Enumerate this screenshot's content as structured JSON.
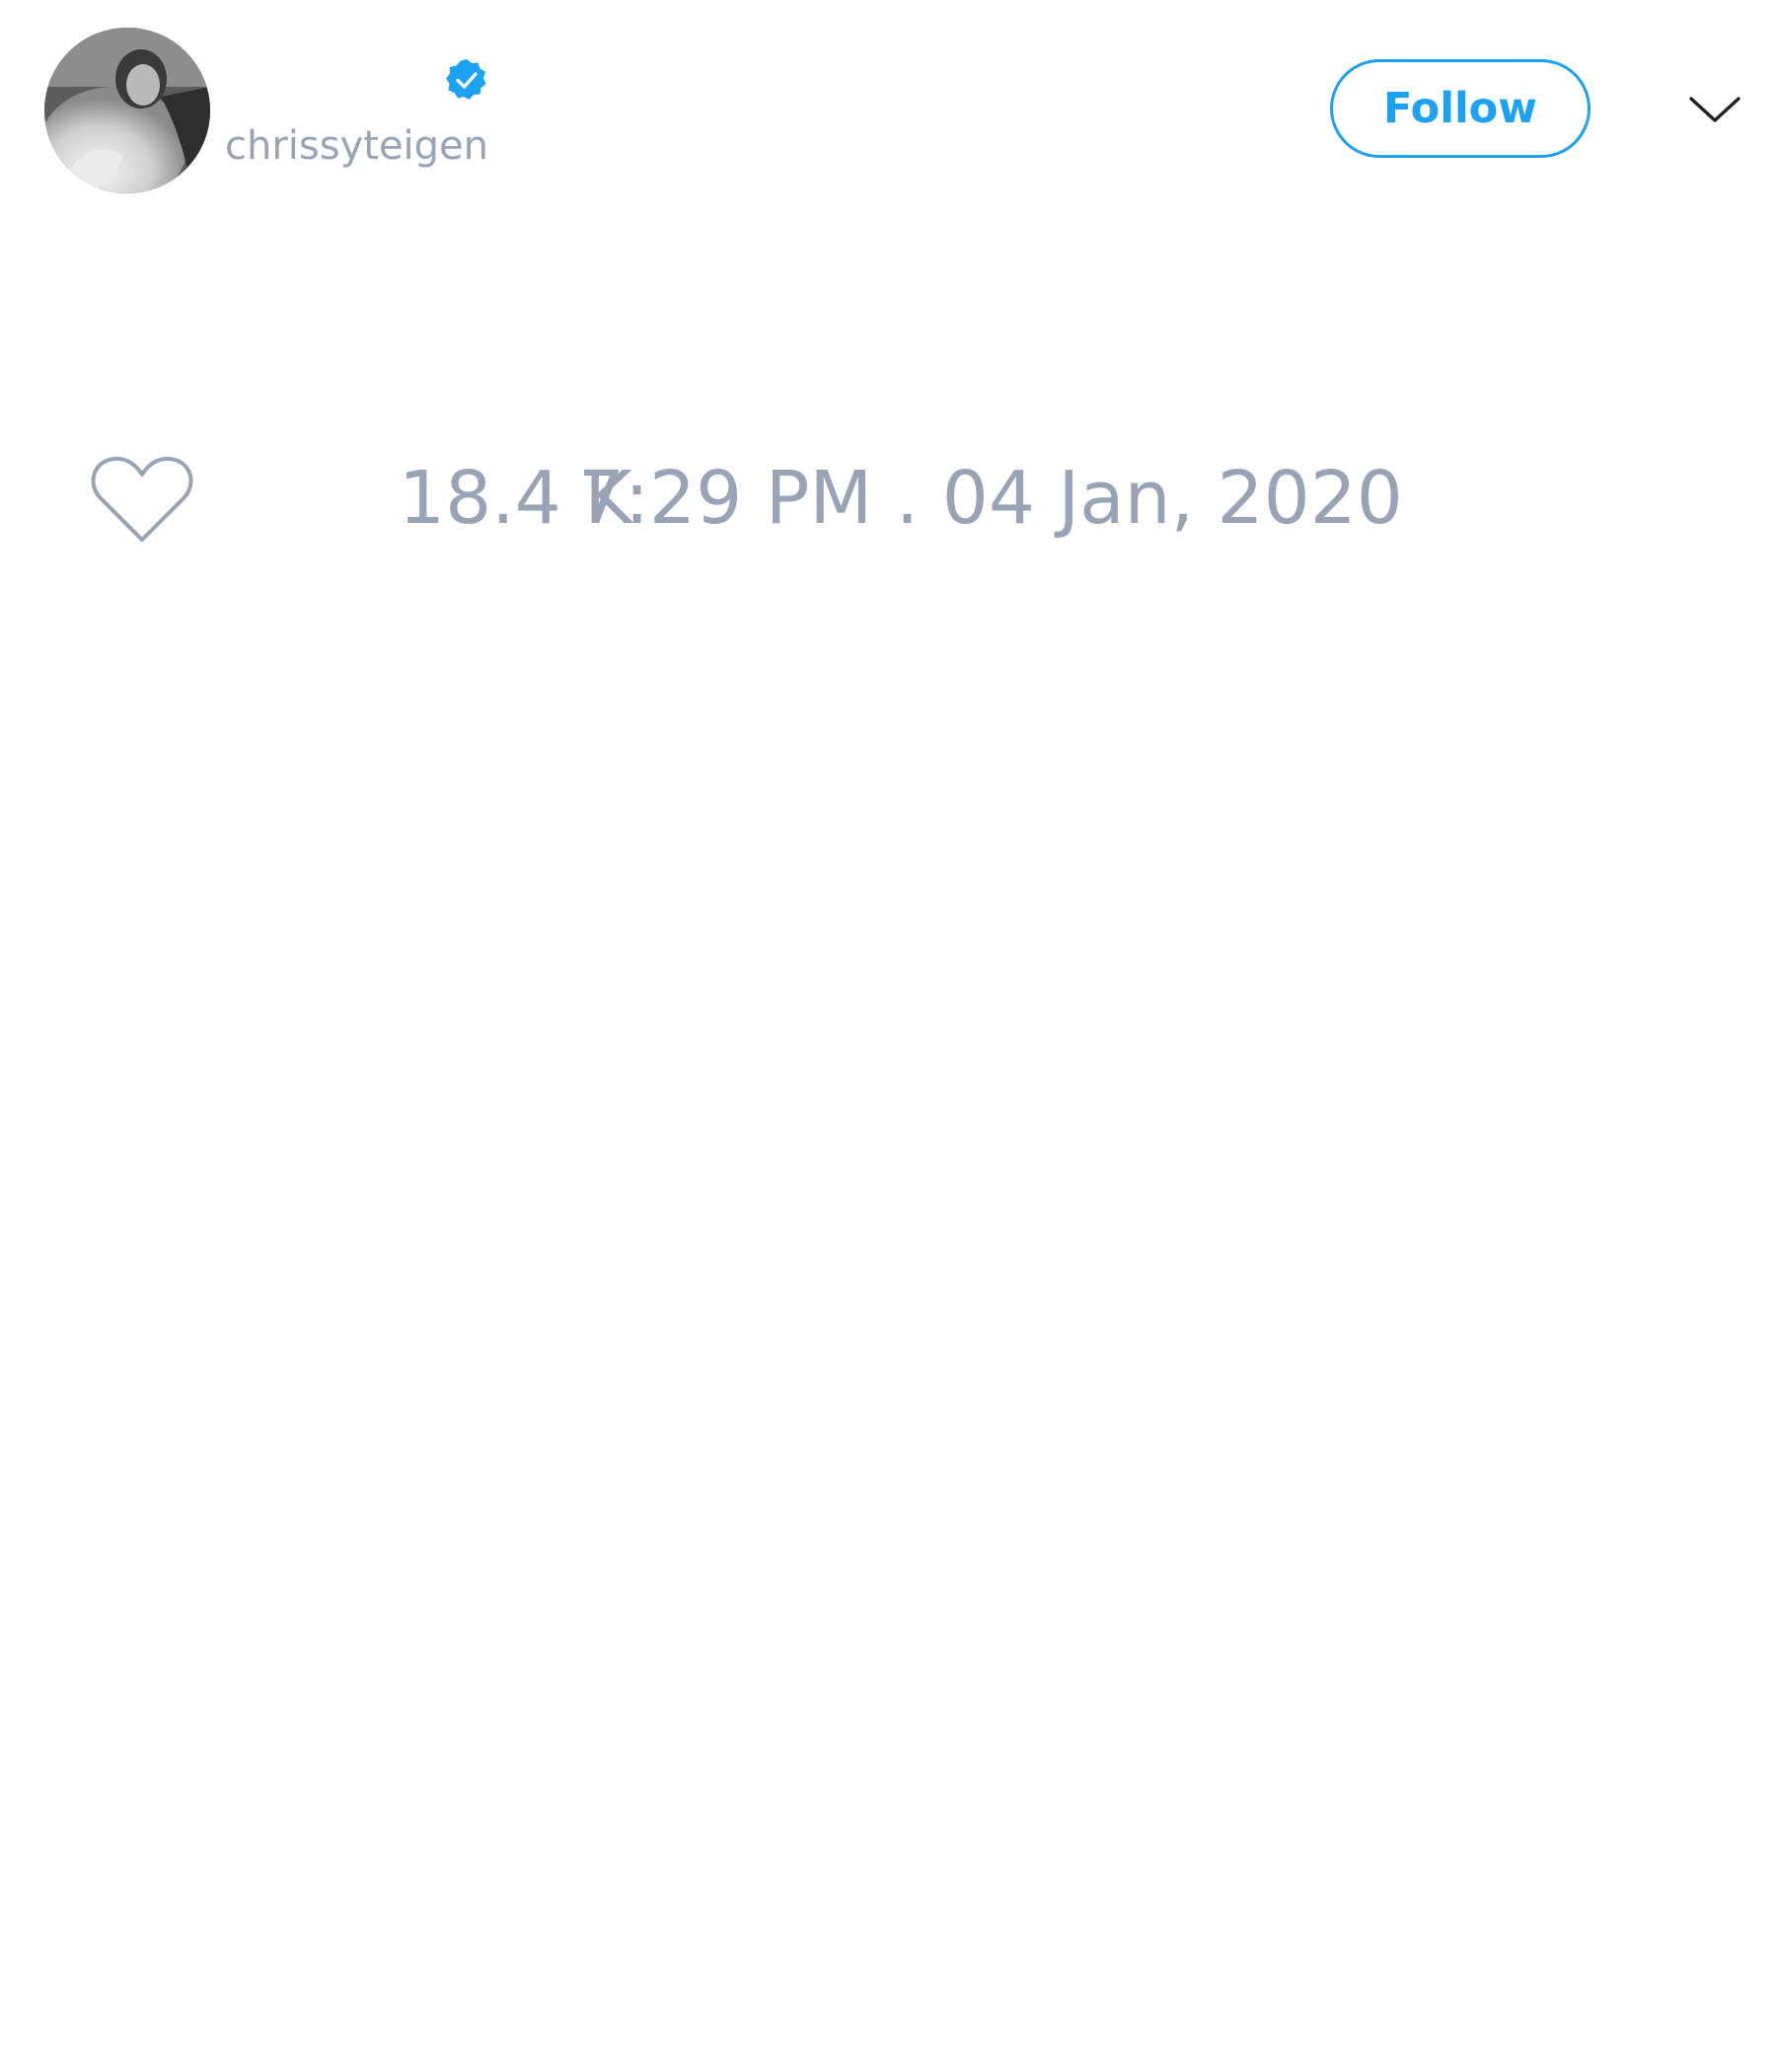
{
  "header": {
    "username": "chrissyteigen",
    "verified": true,
    "follow_label": "Follow",
    "more_icon": "chevron-down-icon",
    "accent_color": "#1da1f2"
  },
  "tweet": {
    "like_icon": "heart-outline-icon",
    "like_count": "18.4 K",
    "timestamp": "7:29 PM . 04 Jan, 2020",
    "meta_color": "#98a4b6"
  }
}
